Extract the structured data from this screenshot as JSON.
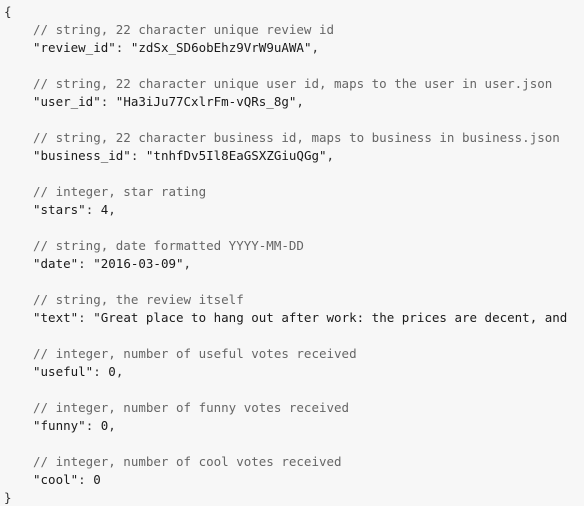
{
  "code": {
    "open_brace": "{",
    "close_brace": "}",
    "fields": [
      {
        "comment": "// string, 22 character unique review id",
        "key": "\"review_id\"",
        "value": "\"zdSx_SD6obEhz9VrW9uAWA\"",
        "trailing": ","
      },
      {
        "comment": "// string, 22 character unique user id, maps to the user in user.json",
        "key": "\"user_id\"",
        "value": "\"Ha3iJu77CxlrFm-vQRs_8g\"",
        "trailing": ","
      },
      {
        "comment": "// string, 22 character business id, maps to business in business.json",
        "key": "\"business_id\"",
        "value": "\"tnhfDv5Il8EaGSXZGiuQGg\"",
        "trailing": ","
      },
      {
        "comment": "// integer, star rating",
        "key": "\"stars\"",
        "value": "4",
        "trailing": ","
      },
      {
        "comment": "// string, date formatted YYYY-MM-DD",
        "key": "\"date\"",
        "value": "\"2016-03-09\"",
        "trailing": ","
      },
      {
        "comment": "// string, the review itself",
        "key": "\"text\"",
        "value": "\"Great place to hang out after work: the prices are decent, and",
        "trailing": ""
      },
      {
        "comment": "// integer, number of useful votes received",
        "key": "\"useful\"",
        "value": "0",
        "trailing": ","
      },
      {
        "comment": "// integer, number of funny votes received",
        "key": "\"funny\"",
        "value": "0",
        "trailing": ","
      },
      {
        "comment": "// integer, number of cool votes received",
        "key": "\"cool\"",
        "value": "0",
        "trailing": ""
      }
    ]
  }
}
